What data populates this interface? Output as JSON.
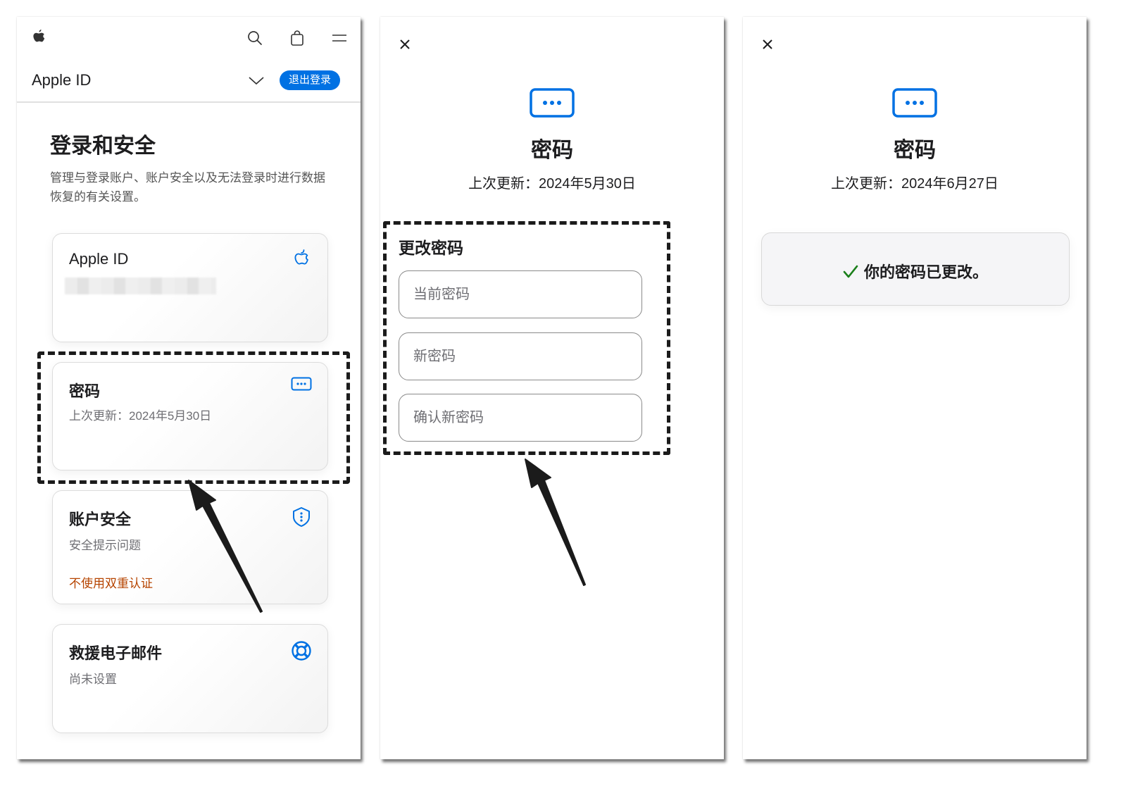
{
  "panel1": {
    "nav": {
      "logo_icon": "apple-logo-icon",
      "search_icon": "search-icon",
      "bag_icon": "shopping-bag-icon",
      "menu_icon": "menu-icon"
    },
    "subnav": {
      "title": "Apple ID",
      "chevron_icon": "chevron-down-icon",
      "signout_label": "退出登录"
    },
    "section": {
      "title": "登录和安全",
      "description": "管理与登录账户、账户安全以及无法登录时进行数据恢复的有关设置。"
    },
    "cards": [
      {
        "title": "Apple ID",
        "subtitle": "",
        "icon": "apple-logo-icon",
        "redacted": true
      },
      {
        "title": "密码",
        "subtitle": "上次更新：2024年5月30日",
        "icon": "password-dots-icon"
      },
      {
        "title": "账户安全",
        "subtitle": "安全提示问题",
        "warning": "不使用双重认证",
        "icon": "shield-icon"
      },
      {
        "title": "救援电子邮件",
        "subtitle": "尚未设置",
        "icon": "lifebuoy-icon"
      }
    ]
  },
  "panel2": {
    "close_icon": "close-icon",
    "title": "密码",
    "last_updated": "上次更新：2024年5月30日",
    "form": {
      "title": "更改密码",
      "fields": [
        {
          "placeholder": "当前密码",
          "value": ""
        },
        {
          "placeholder": "新密码",
          "value": ""
        },
        {
          "placeholder": "确认新密码",
          "value": ""
        }
      ]
    }
  },
  "panel3": {
    "close_icon": "close-icon",
    "title": "密码",
    "last_updated": "上次更新：2024年6月27日",
    "success_message": "你的密码已更改。"
  },
  "colors": {
    "accent": "#0071e3",
    "warning": "#b64400",
    "success": "#1a7f1a",
    "annotation": "#1b1b1b"
  }
}
